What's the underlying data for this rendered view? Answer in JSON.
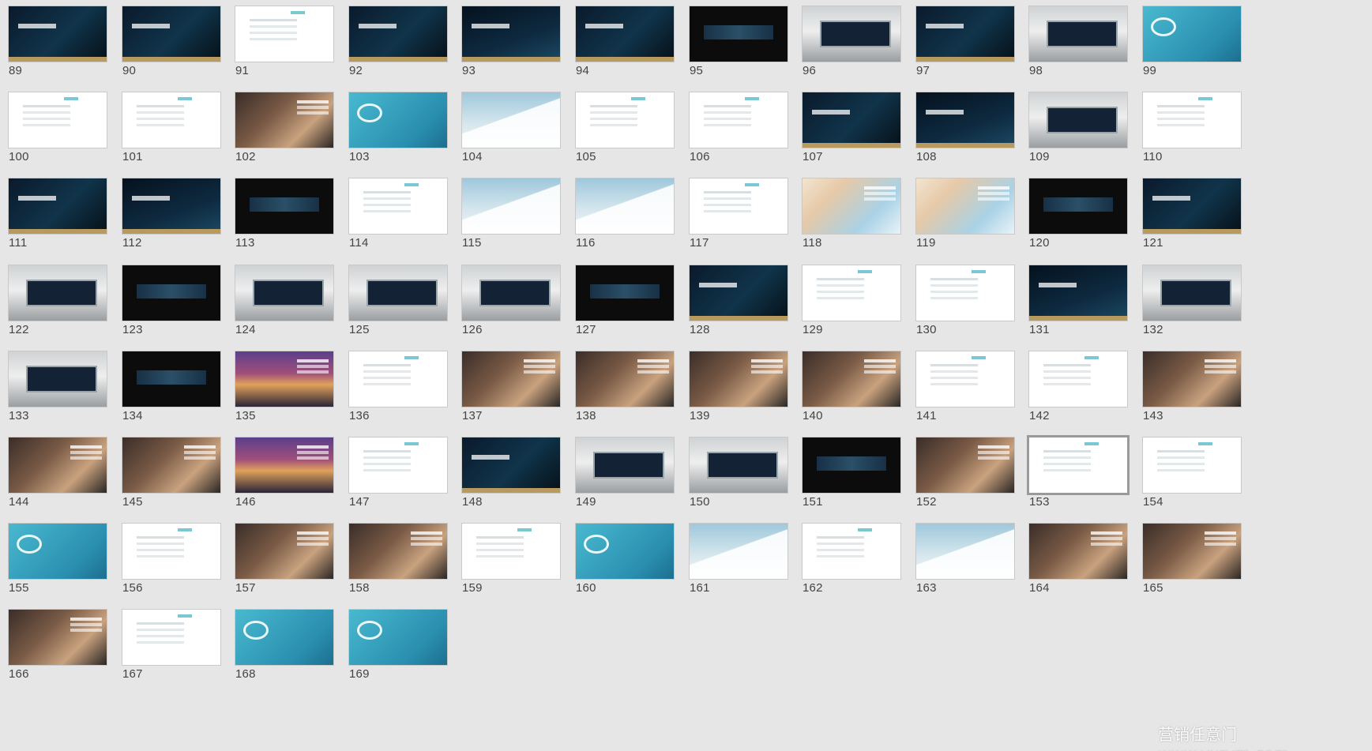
{
  "slides": [
    {
      "n": "89",
      "v": "dark"
    },
    {
      "n": "90",
      "v": "dark"
    },
    {
      "n": "91",
      "v": "whitefaint"
    },
    {
      "n": "92",
      "v": "dark"
    },
    {
      "n": "93",
      "v": "dark2"
    },
    {
      "n": "94",
      "v": "dark"
    },
    {
      "n": "95",
      "v": "black"
    },
    {
      "n": "96",
      "v": "gray"
    },
    {
      "n": "97",
      "v": "dark"
    },
    {
      "n": "98",
      "v": "gray"
    },
    {
      "n": "99",
      "v": "teal"
    },
    {
      "n": "100",
      "v": "whitefaint"
    },
    {
      "n": "101",
      "v": "whitefaint"
    },
    {
      "n": "102",
      "v": "photo"
    },
    {
      "n": "103",
      "v": "teal"
    },
    {
      "n": "104",
      "v": "sky"
    },
    {
      "n": "105",
      "v": "whitefaint"
    },
    {
      "n": "106",
      "v": "whitefaint"
    },
    {
      "n": "107",
      "v": "dark"
    },
    {
      "n": "108",
      "v": "dark2"
    },
    {
      "n": "109",
      "v": "gray"
    },
    {
      "n": "110",
      "v": "whitefaint"
    },
    {
      "n": "111",
      "v": "dark"
    },
    {
      "n": "112",
      "v": "dark2"
    },
    {
      "n": "113",
      "v": "black"
    },
    {
      "n": "114",
      "v": "whitefaint"
    },
    {
      "n": "115",
      "v": "sky"
    },
    {
      "n": "116",
      "v": "sky"
    },
    {
      "n": "117",
      "v": "whitefaint"
    },
    {
      "n": "118",
      "v": "beauty"
    },
    {
      "n": "119",
      "v": "beauty"
    },
    {
      "n": "120",
      "v": "black"
    },
    {
      "n": "121",
      "v": "dark"
    },
    {
      "n": "122",
      "v": "gray"
    },
    {
      "n": "123",
      "v": "black"
    },
    {
      "n": "124",
      "v": "gray"
    },
    {
      "n": "125",
      "v": "gray"
    },
    {
      "n": "126",
      "v": "gray"
    },
    {
      "n": "127",
      "v": "black"
    },
    {
      "n": "128",
      "v": "dark"
    },
    {
      "n": "129",
      "v": "whitefaint"
    },
    {
      "n": "130",
      "v": "whitefaint"
    },
    {
      "n": "131",
      "v": "dark2"
    },
    {
      "n": "132",
      "v": "gray"
    },
    {
      "n": "133",
      "v": "gray"
    },
    {
      "n": "134",
      "v": "black"
    },
    {
      "n": "135",
      "v": "city"
    },
    {
      "n": "136",
      "v": "whitefaint"
    },
    {
      "n": "137",
      "v": "photo"
    },
    {
      "n": "138",
      "v": "photo"
    },
    {
      "n": "139",
      "v": "photo"
    },
    {
      "n": "140",
      "v": "photo"
    },
    {
      "n": "141",
      "v": "whitefaint"
    },
    {
      "n": "142",
      "v": "whitefaint"
    },
    {
      "n": "143",
      "v": "photo"
    },
    {
      "n": "144",
      "v": "photo"
    },
    {
      "n": "145",
      "v": "photo"
    },
    {
      "n": "146",
      "v": "city"
    },
    {
      "n": "147",
      "v": "whitefaint"
    },
    {
      "n": "148",
      "v": "dark"
    },
    {
      "n": "149",
      "v": "gray"
    },
    {
      "n": "150",
      "v": "gray"
    },
    {
      "n": "151",
      "v": "black"
    },
    {
      "n": "152",
      "v": "photo"
    },
    {
      "n": "153",
      "v": "whitefaint",
      "selected": true
    },
    {
      "n": "154",
      "v": "whitefaint"
    },
    {
      "n": "155",
      "v": "teal"
    },
    {
      "n": "156",
      "v": "whitefaint"
    },
    {
      "n": "157",
      "v": "photo"
    },
    {
      "n": "158",
      "v": "photo"
    },
    {
      "n": "159",
      "v": "whitefaint"
    },
    {
      "n": "160",
      "v": "teal"
    },
    {
      "n": "161",
      "v": "sky"
    },
    {
      "n": "162",
      "v": "whitefaint"
    },
    {
      "n": "163",
      "v": "sky"
    },
    {
      "n": "164",
      "v": "photo"
    },
    {
      "n": "165",
      "v": "photo"
    },
    {
      "n": "166",
      "v": "photo"
    },
    {
      "n": "167",
      "v": "whitefaint"
    },
    {
      "n": "168",
      "v": "teal"
    },
    {
      "n": "169",
      "v": "teal"
    }
  ],
  "watermark": "营销任意门 www.yxrym.com"
}
